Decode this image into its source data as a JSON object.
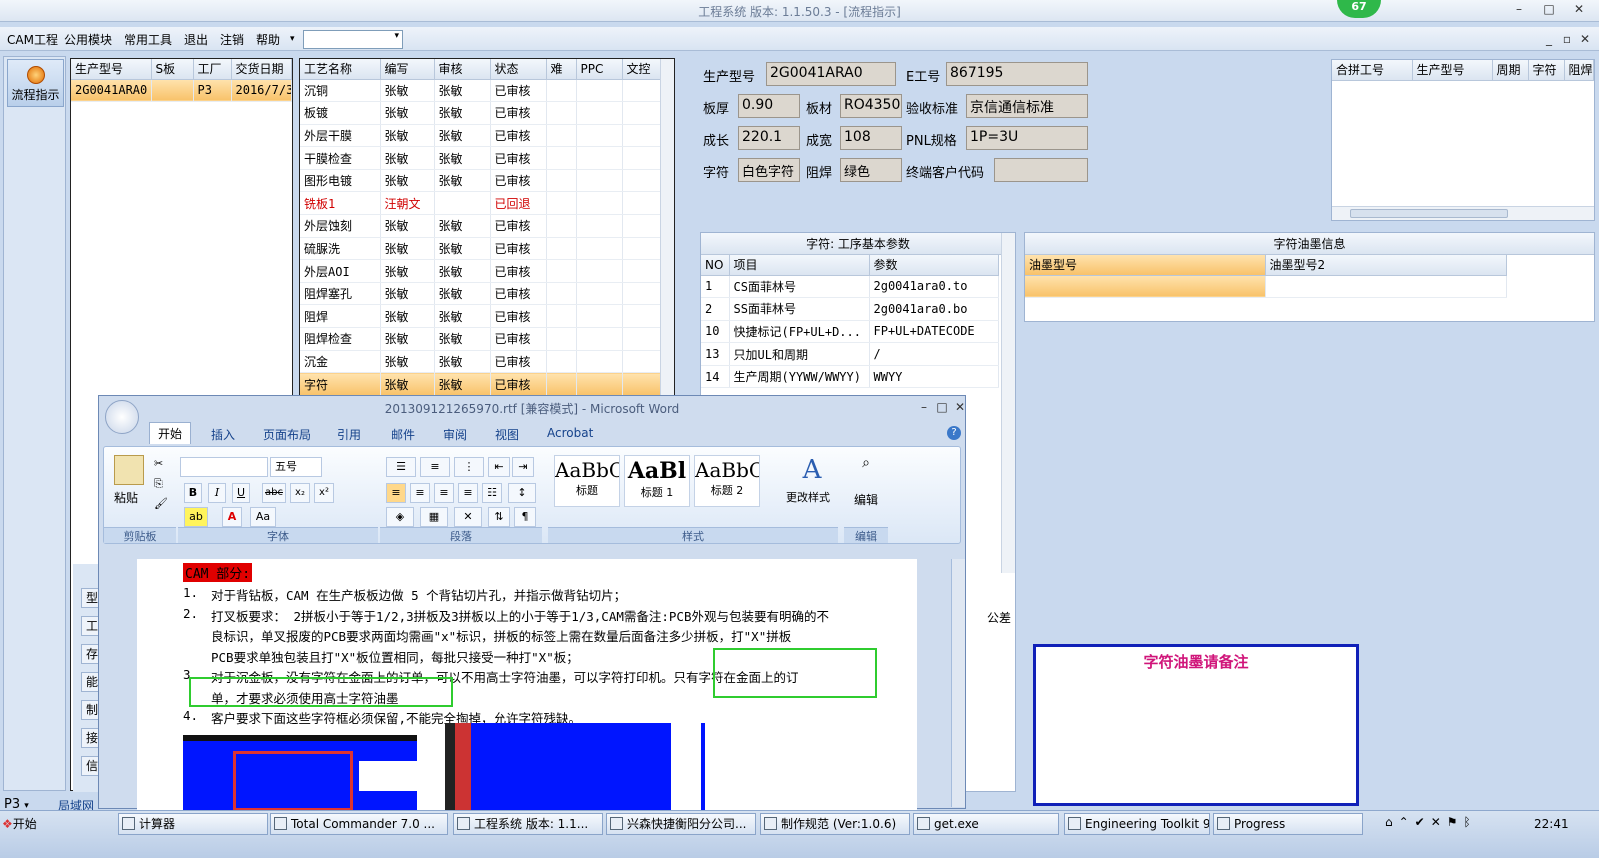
{
  "window": {
    "title": "工程系统  版本: 1.1.50.3 - [流程指示]",
    "badge": "67"
  },
  "menu": {
    "items": [
      "CAM工程",
      "公用模块",
      "常用工具",
      "退出",
      "注销",
      "帮助"
    ],
    "dropdown_arrow": "▾"
  },
  "leftnav": {
    "flow_button": "流程指示",
    "bottom_combo": "P3",
    "bottom_tab": "局域网",
    "side_tabs": [
      "型",
      "工",
      "存",
      "能",
      "制",
      "接",
      "信"
    ]
  },
  "orders": {
    "headers": [
      "生产型号",
      "S板",
      "工厂",
      "交货日期"
    ],
    "rows": [
      [
        "2G0041ARA0",
        "",
        "P3",
        "2016/7/3"
      ]
    ]
  },
  "process": {
    "headers": [
      "工艺名称",
      "编写",
      "审核",
      "状态",
      "难",
      "PPC",
      "文控"
    ],
    "rows": [
      [
        "沉铜",
        "张敏",
        "张敏",
        "已审核"
      ],
      [
        "板镀",
        "张敏",
        "张敏",
        "已审核"
      ],
      [
        "外层干膜",
        "张敏",
        "张敏",
        "已审核"
      ],
      [
        "干膜检查",
        "张敏",
        "张敏",
        "已审核"
      ],
      [
        "图形电镀",
        "张敏",
        "张敏",
        "已审核"
      ],
      [
        "铣板1",
        "汪朝文",
        "",
        "已回退"
      ],
      [
        "外层蚀刻",
        "张敏",
        "张敏",
        "已审核"
      ],
      [
        "硫脲洗",
        "张敏",
        "张敏",
        "已审核"
      ],
      [
        "外层AOI",
        "张敏",
        "张敏",
        "已审核"
      ],
      [
        "阻焊塞孔",
        "张敏",
        "张敏",
        "已审核"
      ],
      [
        "阻焊",
        "张敏",
        "张敏",
        "已审核"
      ],
      [
        "阻焊检查",
        "张敏",
        "张敏",
        "已审核"
      ],
      [
        "沉金",
        "张敏",
        "张敏",
        "已审核"
      ],
      [
        "字符",
        "张敏",
        "张敏",
        "已审核"
      ]
    ]
  },
  "info": {
    "model_label": "生产型号",
    "model": "2G0041ARA0",
    "e_label": "E工号",
    "e": "867195",
    "thick_label": "板厚",
    "thick": "0.90",
    "material_label": "板材",
    "material": "RO4350B",
    "std_label": "验收标准",
    "std": "京信通信标准",
    "len_label": "成长",
    "len": "220.1",
    "wid_label": "成宽",
    "wid": "108",
    "pnl_label": "PNL规格",
    "pnl": "1P=3U",
    "char_label": "字符",
    "char": "白色字符",
    "mask_label": "阻焊",
    "mask": "绿色",
    "cust_label": "终端客户代码",
    "cust": ""
  },
  "merge": {
    "headers": [
      "合拼工号",
      "生产型号",
      "周期",
      "字符",
      "阻焊"
    ]
  },
  "params": {
    "title": "字符: 工序基本参数",
    "headers": [
      "NO",
      "项目",
      "参数"
    ],
    "rows": [
      [
        "1",
        "CS面菲林号",
        "2g0041ara0.to"
      ],
      [
        "2",
        "SS面菲林号",
        "2g0041ara0.bo"
      ],
      [
        "10",
        "快捷标记(FP+UL+D...",
        "FP+UL+DATECODE"
      ],
      [
        "13",
        "只加UL和周期",
        "/"
      ],
      [
        "14",
        "生产周期(YYWW/WWYY)",
        "WWYY"
      ]
    ],
    "partial_label": "公差"
  },
  "ink": {
    "title": "字符油墨信息",
    "headers": [
      "油墨型号",
      "油墨型号2"
    ],
    "note_title": "字符油墨请备注"
  },
  "word": {
    "title": "201309121265970.rtf [兼容模式] - Microsoft Word",
    "tabs": [
      "开始",
      "插入",
      "页面布局",
      "引用",
      "邮件",
      "审阅",
      "视图",
      "Acrobat"
    ],
    "font_size": "五号",
    "groups": [
      "剪贴板",
      "字体",
      "段落",
      "样式",
      "编辑"
    ],
    "paste": "粘贴",
    "styles": [
      {
        "sample": "AaBbC",
        "name": "标题"
      },
      {
        "sample": "AaBl",
        "name": "标题 1"
      },
      {
        "sample": "AaBbC",
        "name": "标题 2"
      }
    ],
    "change_styles": "更改样式",
    "edit": "编辑",
    "doc_heading": "CAM 部分:",
    "lines": [
      {
        "n": "1.",
        "t": "对于背钻板，CAM 在生产板板边做 5 个背钻切片孔，并指示做背钻切片；"
      },
      {
        "n": "2.",
        "t": "打叉板要求： 2拼板小于等于1/2,3拼板及3拼板以上的小于等于1/3,CAM需备注:PCB外观与包装要有明确的不"
      },
      {
        "n": "",
        "t": "良标识，单叉报废的PCB要求两面均需画\"x\"标识，拼板的标签上需在数量后面备注多少拼板，打\"X\"拼板"
      },
      {
        "n": "",
        "t": "PCB要求单独包装且打\"X\"板位置相同，每批只接受一种打\"X\"板；"
      },
      {
        "n": "3.",
        "t": "对于沉金板，没有字符在金面上的订单，可以不用高士字符油墨，可以字符打印机。只有字符在金面上的订"
      },
      {
        "n": "",
        "t": "单，才要求必须使用高士字符油墨"
      },
      {
        "n": "4.",
        "t": "客户要求下面这些字符框必须保留,不能完全掏掉，允许字符残缺。"
      }
    ]
  },
  "taskbar": {
    "start": "开始",
    "tasks": [
      "计算器",
      "Total Commander 7.0 ...",
      "工程系统  版本: 1.1...",
      "兴森快捷衡阳分公司...",
      "制作规范 (Ver:1.0.6)",
      "get.exe",
      "Engineering Toolkit 9.0...",
      "Progress"
    ],
    "clock": "22:41"
  }
}
